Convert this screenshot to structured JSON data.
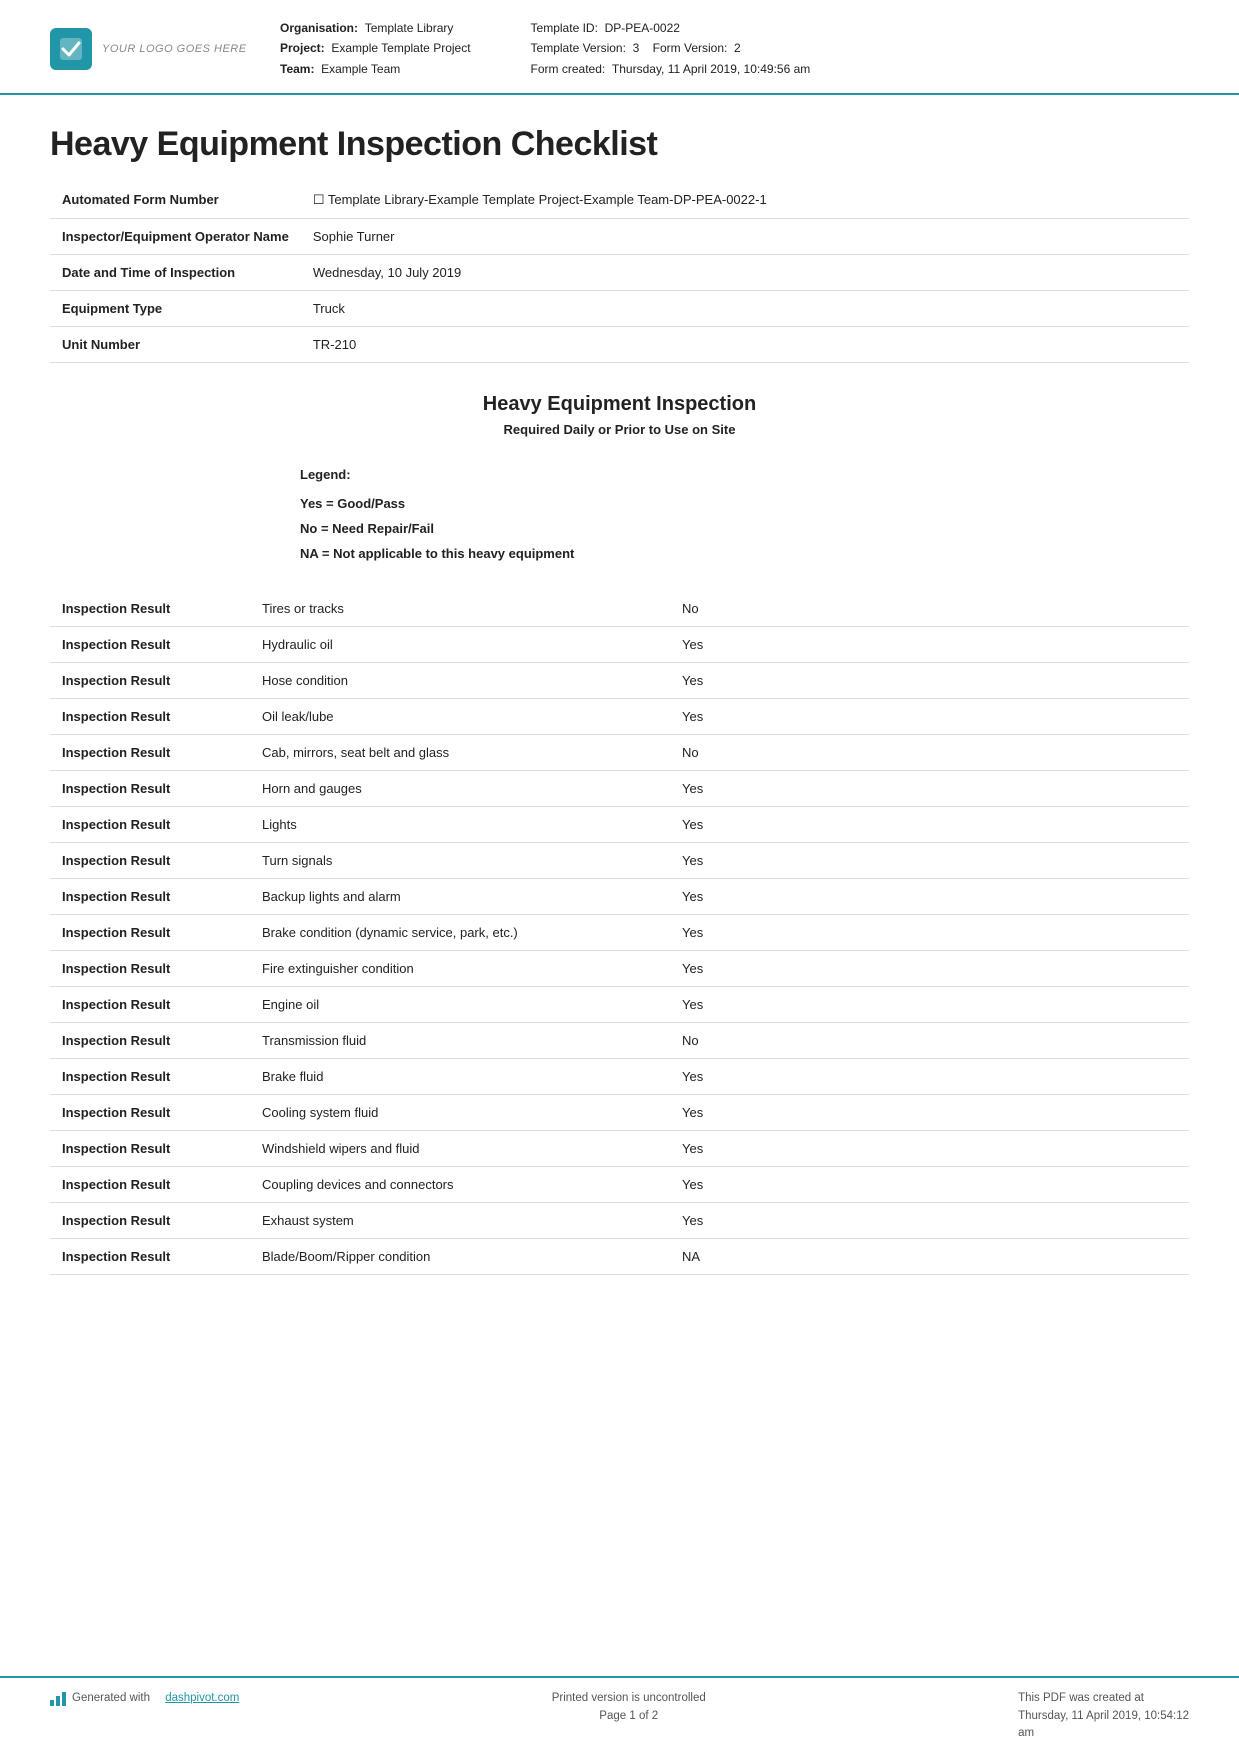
{
  "header": {
    "logo_text": "YOUR LOGO GOES HERE",
    "org_label": "Organisation:",
    "org_value": "Template Library",
    "project_label": "Project:",
    "project_value": "Example Template Project",
    "team_label": "Team:",
    "team_value": "Example Team",
    "template_id_label": "Template ID:",
    "template_id_value": "DP-PEA-0022",
    "template_version_label": "Template Version:",
    "template_version_value": "3",
    "form_version_label": "Form Version:",
    "form_version_value": "2",
    "form_created_label": "Form created:",
    "form_created_value": "Thursday, 11 April 2019, 10:49:56 am"
  },
  "document": {
    "title": "Heavy Equipment Inspection Checklist"
  },
  "info_rows": [
    {
      "label": "Automated Form Number",
      "value": "☐ Template Library-Example Template Project-Example Team-DP-PEA-0022-1"
    },
    {
      "label": "Inspector/Equipment Operator Name",
      "value": "Sophie Turner"
    },
    {
      "label": "Date and Time of Inspection",
      "value": "Wednesday, 10 July 2019"
    },
    {
      "label": "Equipment Type",
      "value": "Truck"
    },
    {
      "label": "Unit Number",
      "value": "TR-210"
    }
  ],
  "section": {
    "title": "Heavy Equipment Inspection",
    "subtitle": "Required Daily or Prior to Use on Site"
  },
  "legend": {
    "label": "Legend:",
    "items": [
      "Yes = Good/Pass",
      "No = Need Repair/Fail",
      "NA = Not applicable to this heavy equipment"
    ]
  },
  "inspection_rows": [
    {
      "label": "Inspection Result",
      "item": "Tires or tracks",
      "result": "No"
    },
    {
      "label": "Inspection Result",
      "item": "Hydraulic oil",
      "result": "Yes"
    },
    {
      "label": "Inspection Result",
      "item": "Hose condition",
      "result": "Yes"
    },
    {
      "label": "Inspection Result",
      "item": "Oil leak/lube",
      "result": "Yes"
    },
    {
      "label": "Inspection Result",
      "item": "Cab, mirrors, seat belt and glass",
      "result": "No"
    },
    {
      "label": "Inspection Result",
      "item": "Horn and gauges",
      "result": "Yes"
    },
    {
      "label": "Inspection Result",
      "item": "Lights",
      "result": "Yes"
    },
    {
      "label": "Inspection Result",
      "item": "Turn signals",
      "result": "Yes"
    },
    {
      "label": "Inspection Result",
      "item": "Backup lights and alarm",
      "result": "Yes"
    },
    {
      "label": "Inspection Result",
      "item": "Brake condition (dynamic service, park, etc.)",
      "result": "Yes"
    },
    {
      "label": "Inspection Result",
      "item": "Fire extinguisher condition",
      "result": "Yes"
    },
    {
      "label": "Inspection Result",
      "item": "Engine oil",
      "result": "Yes"
    },
    {
      "label": "Inspection Result",
      "item": "Transmission fluid",
      "result": "No"
    },
    {
      "label": "Inspection Result",
      "item": "Brake fluid",
      "result": "Yes"
    },
    {
      "label": "Inspection Result",
      "item": "Cooling system fluid",
      "result": "Yes"
    },
    {
      "label": "Inspection Result",
      "item": "Windshield wipers and fluid",
      "result": "Yes"
    },
    {
      "label": "Inspection Result",
      "item": "Coupling devices and connectors",
      "result": "Yes"
    },
    {
      "label": "Inspection Result",
      "item": "Exhaust system",
      "result": "Yes"
    },
    {
      "label": "Inspection Result",
      "item": "Blade/Boom/Ripper condition",
      "result": "NA"
    }
  ],
  "footer": {
    "generated_with": "Generated with",
    "link_text": "dashpivot.com",
    "link_url": "dashpivot.com",
    "center_line1": "Printed version is uncontrolled",
    "center_line2": "Page 1 of 2",
    "right_line1": "This PDF was created at",
    "right_line2": "Thursday, 11 April 2019, 10:54:12",
    "right_line3": "am"
  }
}
